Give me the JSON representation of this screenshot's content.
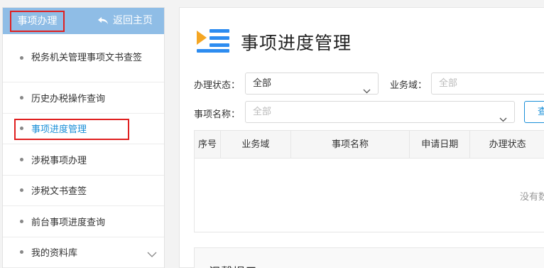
{
  "sidebar": {
    "title": "事项办理",
    "back_label": "返回主页",
    "items": [
      {
        "label": "税务机关管理事项文书查签"
      },
      {
        "label": "历史办税操作查询"
      },
      {
        "label": "事项进度管理"
      },
      {
        "label": "涉税事项办理"
      },
      {
        "label": "涉税文书查签"
      },
      {
        "label": "前台事项进度查询"
      },
      {
        "label": "我的资料库"
      }
    ]
  },
  "main": {
    "title": "事项进度管理",
    "filters": {
      "status_label": "办理状态：",
      "status_value": "全部",
      "domain_label": "业务域：",
      "domain_placeholder": "全部",
      "name_label": "事项名称：",
      "name_placeholder": "全部",
      "query_label": "查"
    },
    "table": {
      "columns": [
        "序号",
        "业务域",
        "事项名称",
        "申请日期",
        "办理状态"
      ],
      "empty_text": "没有数"
    },
    "tips": {
      "title": "温馨提示"
    }
  },
  "colors": {
    "accent": "#1a8fd8",
    "header_bg": "#8fbde6",
    "highlight_border": "#e02020",
    "icon_orange": "#f5a623",
    "icon_blue": "#2d8cf0"
  }
}
